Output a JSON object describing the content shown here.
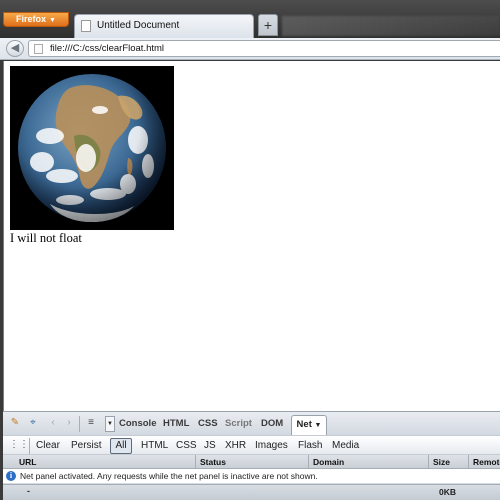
{
  "browser": {
    "menu_button": "Firefox",
    "tab_title": "Untitled Document",
    "new_tab": "+",
    "url": "file:///C:/css/clearFloat.html"
  },
  "page": {
    "image_alt": "Earth globe image",
    "text": "I will not float"
  },
  "firebug": {
    "tabs": [
      "Console",
      "HTML",
      "CSS",
      "Script",
      "DOM"
    ],
    "active_tab": "Net",
    "net_toolbar": {
      "clear": "Clear",
      "persist": "Persist",
      "filters": [
        "All",
        "HTML",
        "CSS",
        "JS",
        "XHR",
        "Images",
        "Flash",
        "Media"
      ]
    },
    "columns": [
      "URL",
      "Status",
      "Domain",
      "Size",
      "Remote"
    ],
    "info_message": "Net panel activated. Any requests while the net panel is inactive are not shown.",
    "summary_dash": "-",
    "summary_size": "0KB"
  },
  "colors": {
    "firefox_orange": "#e0701a",
    "info_blue": "#2b6fc7"
  }
}
